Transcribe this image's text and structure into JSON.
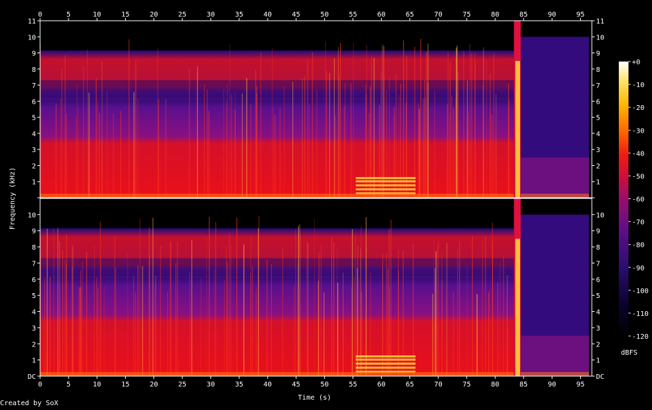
{
  "chart_data": {
    "type": "heatmap",
    "title": "",
    "xlabel": "Time (s)",
    "ylabel": "Frequency (kHz)",
    "x_ticks": [
      "0",
      "5",
      "10",
      "15",
      "20",
      "25",
      "30",
      "35",
      "40",
      "45",
      "50",
      "55",
      "60",
      "65",
      "70",
      "75",
      "80",
      "85",
      "90",
      "95"
    ],
    "xlim": [
      0,
      97
    ],
    "y_ticks": [
      "DC",
      "1",
      "2",
      "3",
      "4",
      "5",
      "6",
      "7",
      "8",
      "9",
      "10",
      "11"
    ],
    "ylim": [
      0,
      11
    ],
    "channels": [
      {
        "name": "",
        "band_limit_khz": 10
      },
      {
        "name": "",
        "band_limit_khz": 10
      }
    ],
    "features": {
      "loud_burst_time_s": [
        83.3,
        84.5
      ],
      "tonal_region_time_s": [
        55.5,
        66.0
      ],
      "tonal_region_freq_khz": [
        0.2,
        1.4
      ],
      "quiet_band_freq_khz": [
        6.2,
        7.3
      ],
      "decay_start_s": 84.5,
      "audio_end_s": 96.5
    },
    "colorbar": {
      "label": "dBFS",
      "ticks": [
        "+0",
        "-10",
        "-20",
        "-30",
        "-40",
        "-50",
        "-60",
        "-70",
        "-80",
        "-90",
        "-100",
        "-110",
        "-120"
      ],
      "range": [
        -120,
        0
      ]
    }
  },
  "footer": {
    "credit": "Created by SoX"
  },
  "colors": {
    "background": "#000000",
    "axis": "#ffffff"
  }
}
